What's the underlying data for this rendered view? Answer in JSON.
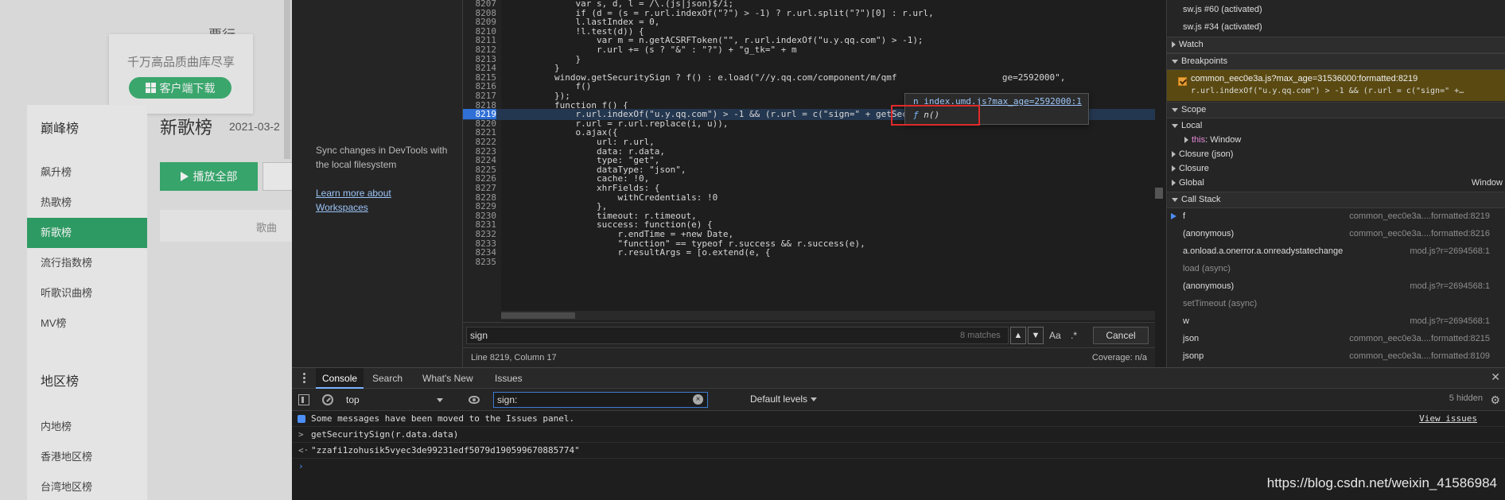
{
  "webpage": {
    "top_title": "票行",
    "card_text": "千万高品质曲库尽享",
    "download_button": "客户端下载",
    "group_peak": "巅峰榜",
    "peak_items": [
      "飙升榜",
      "热歌榜",
      "新歌榜",
      "流行指数榜",
      "听歌识曲榜",
      "MV榜"
    ],
    "active_item": "新歌榜",
    "group_region": "地区榜",
    "region_items": [
      "内地榜",
      "香港地区榜",
      "台湾地区榜"
    ],
    "heading": "新歌榜",
    "date": "2021-03-2",
    "play_all": "播放全部",
    "col_song": "歌曲"
  },
  "navigator": {
    "sync_text": "Sync changes in DevTools with the local filesystem",
    "learn_link": "Learn more about Workspaces"
  },
  "editor": {
    "lines": [
      {
        "n": "8207",
        "t": "            var s, d, l = /\\.(js|json)$/i;"
      },
      {
        "n": "8208",
        "t": "            if (d = (s = r.url.indexOf(\"?\") > -1) ? r.url.split(\"?\")[0] : r.url,"
      },
      {
        "n": "8209",
        "t": "            l.lastIndex = 0,"
      },
      {
        "n": "8210",
        "t": "            !l.test(d)) {"
      },
      {
        "n": "8211",
        "t": "                var m = n.getACSRFToken(\"\", r.url.indexOf(\"u.y.qq.com\") > -1);"
      },
      {
        "n": "8212",
        "t": "                r.url += (s ? \"&\" : \"?\") + \"g_tk=\" + m"
      },
      {
        "n": "8213",
        "t": "            }"
      },
      {
        "n": "8214",
        "t": "        }"
      },
      {
        "n": "8215",
        "t": "        window.getSecuritySign ? f() : e.load(\"//y.qq.com/component/m/qmf                    ge=2592000\","
      },
      {
        "n": "8216",
        "t": "            f()"
      },
      {
        "n": "8217",
        "t": "        });"
      },
      {
        "n": "8218",
        "t": "        function f() {"
      },
      {
        "n": "8219",
        "t": "            r.url.indexOf(\"u.y.qq.com\") > -1 && (r.url = c(\"sign=\" + getSecuritySign(r.data.data), r.url),"
      },
      {
        "n": "8220",
        "t": "            r.url = r.url.replace(i, u)),"
      },
      {
        "n": "8221",
        "t": "            o.ajax({"
      },
      {
        "n": "8222",
        "t": "                url: r.url,"
      },
      {
        "n": "8223",
        "t": "                data: r.data,"
      },
      {
        "n": "8224",
        "t": "                type: \"get\","
      },
      {
        "n": "8225",
        "t": "                dataType: \"json\","
      },
      {
        "n": "8226",
        "t": "                cache: !0,"
      },
      {
        "n": "8227",
        "t": "                xhrFields: {"
      },
      {
        "n": "8228",
        "t": "                    withCredentials: !0"
      },
      {
        "n": "8229",
        "t": "                },"
      },
      {
        "n": "8230",
        "t": "                timeout: r.timeout,"
      },
      {
        "n": "8231",
        "t": "                success: function(e) {"
      },
      {
        "n": "8232",
        "t": "                    r.endTime = +new Date,"
      },
      {
        "n": "8233",
        "t": "                    \"function\" == typeof r.success && r.success(e),"
      },
      {
        "n": "8234",
        "t": "                    r.resultArgs = [o.extend(e, {"
      },
      {
        "n": "8235",
        "t": ""
      }
    ],
    "highlight_line": "8219",
    "popup_link": "n  index.umd.js?max_age=2592000:1",
    "popup_fn_kw": "ƒ",
    "popup_fn": "n()"
  },
  "search": {
    "value": "sign",
    "matches": "8 matches",
    "up": "▲",
    "down": "▼",
    "case_btn": "Aa",
    "regex_btn": ".*",
    "cancel": "Cancel"
  },
  "status": {
    "position": "Line 8219, Column 17",
    "coverage": "Coverage: n/a"
  },
  "debugger": {
    "threads": [
      "sw.js #60 (activated)",
      "sw.js #34 (activated)"
    ],
    "watch": "Watch",
    "breakpoints": "Breakpoints",
    "bp_file": "common_eec0e3a.js?max_age=31536000:formatted:8219",
    "bp_cond": "r.url.indexOf(\"u.y.qq.com\") > -1 && (r.url = c(\"sign=\" +…",
    "scope": "Scope",
    "local": "Local",
    "this_kw": "this",
    "this_val": ": Window",
    "closure_json": "Closure (json)",
    "closure": "Closure",
    "global": "Global",
    "global_val": "Window",
    "call_stack": "Call Stack",
    "frames": [
      {
        "name": "f",
        "loc": "common_eec0e3a....formatted:8219",
        "async": false,
        "current": true
      },
      {
        "name": "(anonymous)",
        "loc": "common_eec0e3a....formatted:8216",
        "async": false
      },
      {
        "name": "a.onload.a.onerror.a.onreadystatechange",
        "loc": "mod.js?r=2694568:1",
        "async": false
      },
      {
        "name": "load (async)",
        "loc": "",
        "async": true
      },
      {
        "name": "(anonymous)",
        "loc": "mod.js?r=2694568:1",
        "async": false
      },
      {
        "name": "setTimeout (async)",
        "loc": "",
        "async": true
      },
      {
        "name": "w",
        "loc": "mod.js?r=2694568:1",
        "async": false
      },
      {
        "name": "json",
        "loc": "common_eec0e3a....formatted:8215",
        "async": false
      },
      {
        "name": "jsonp",
        "loc": "common_eec0e3a....formatted:8109",
        "async": false
      }
    ]
  },
  "console": {
    "tabs": [
      "Console",
      "Search",
      "What's New",
      "Issues"
    ],
    "context": "top",
    "filter": "sign:",
    "levels": "Default levels",
    "hidden": "5 hidden",
    "moved_msg": "Some messages have been moved to the Issues panel.",
    "view_issues": "View issues",
    "input_expr": "getSecuritySign(r.data.data)",
    "result": "\"zzafi1zohusik5vyec3de99231edf5079d190599670885774\"",
    "input_prefix": ">",
    "result_prefix": "<·",
    "prompt": "›"
  },
  "watermark": "https://blog.csdn.net/weixin_41586984"
}
